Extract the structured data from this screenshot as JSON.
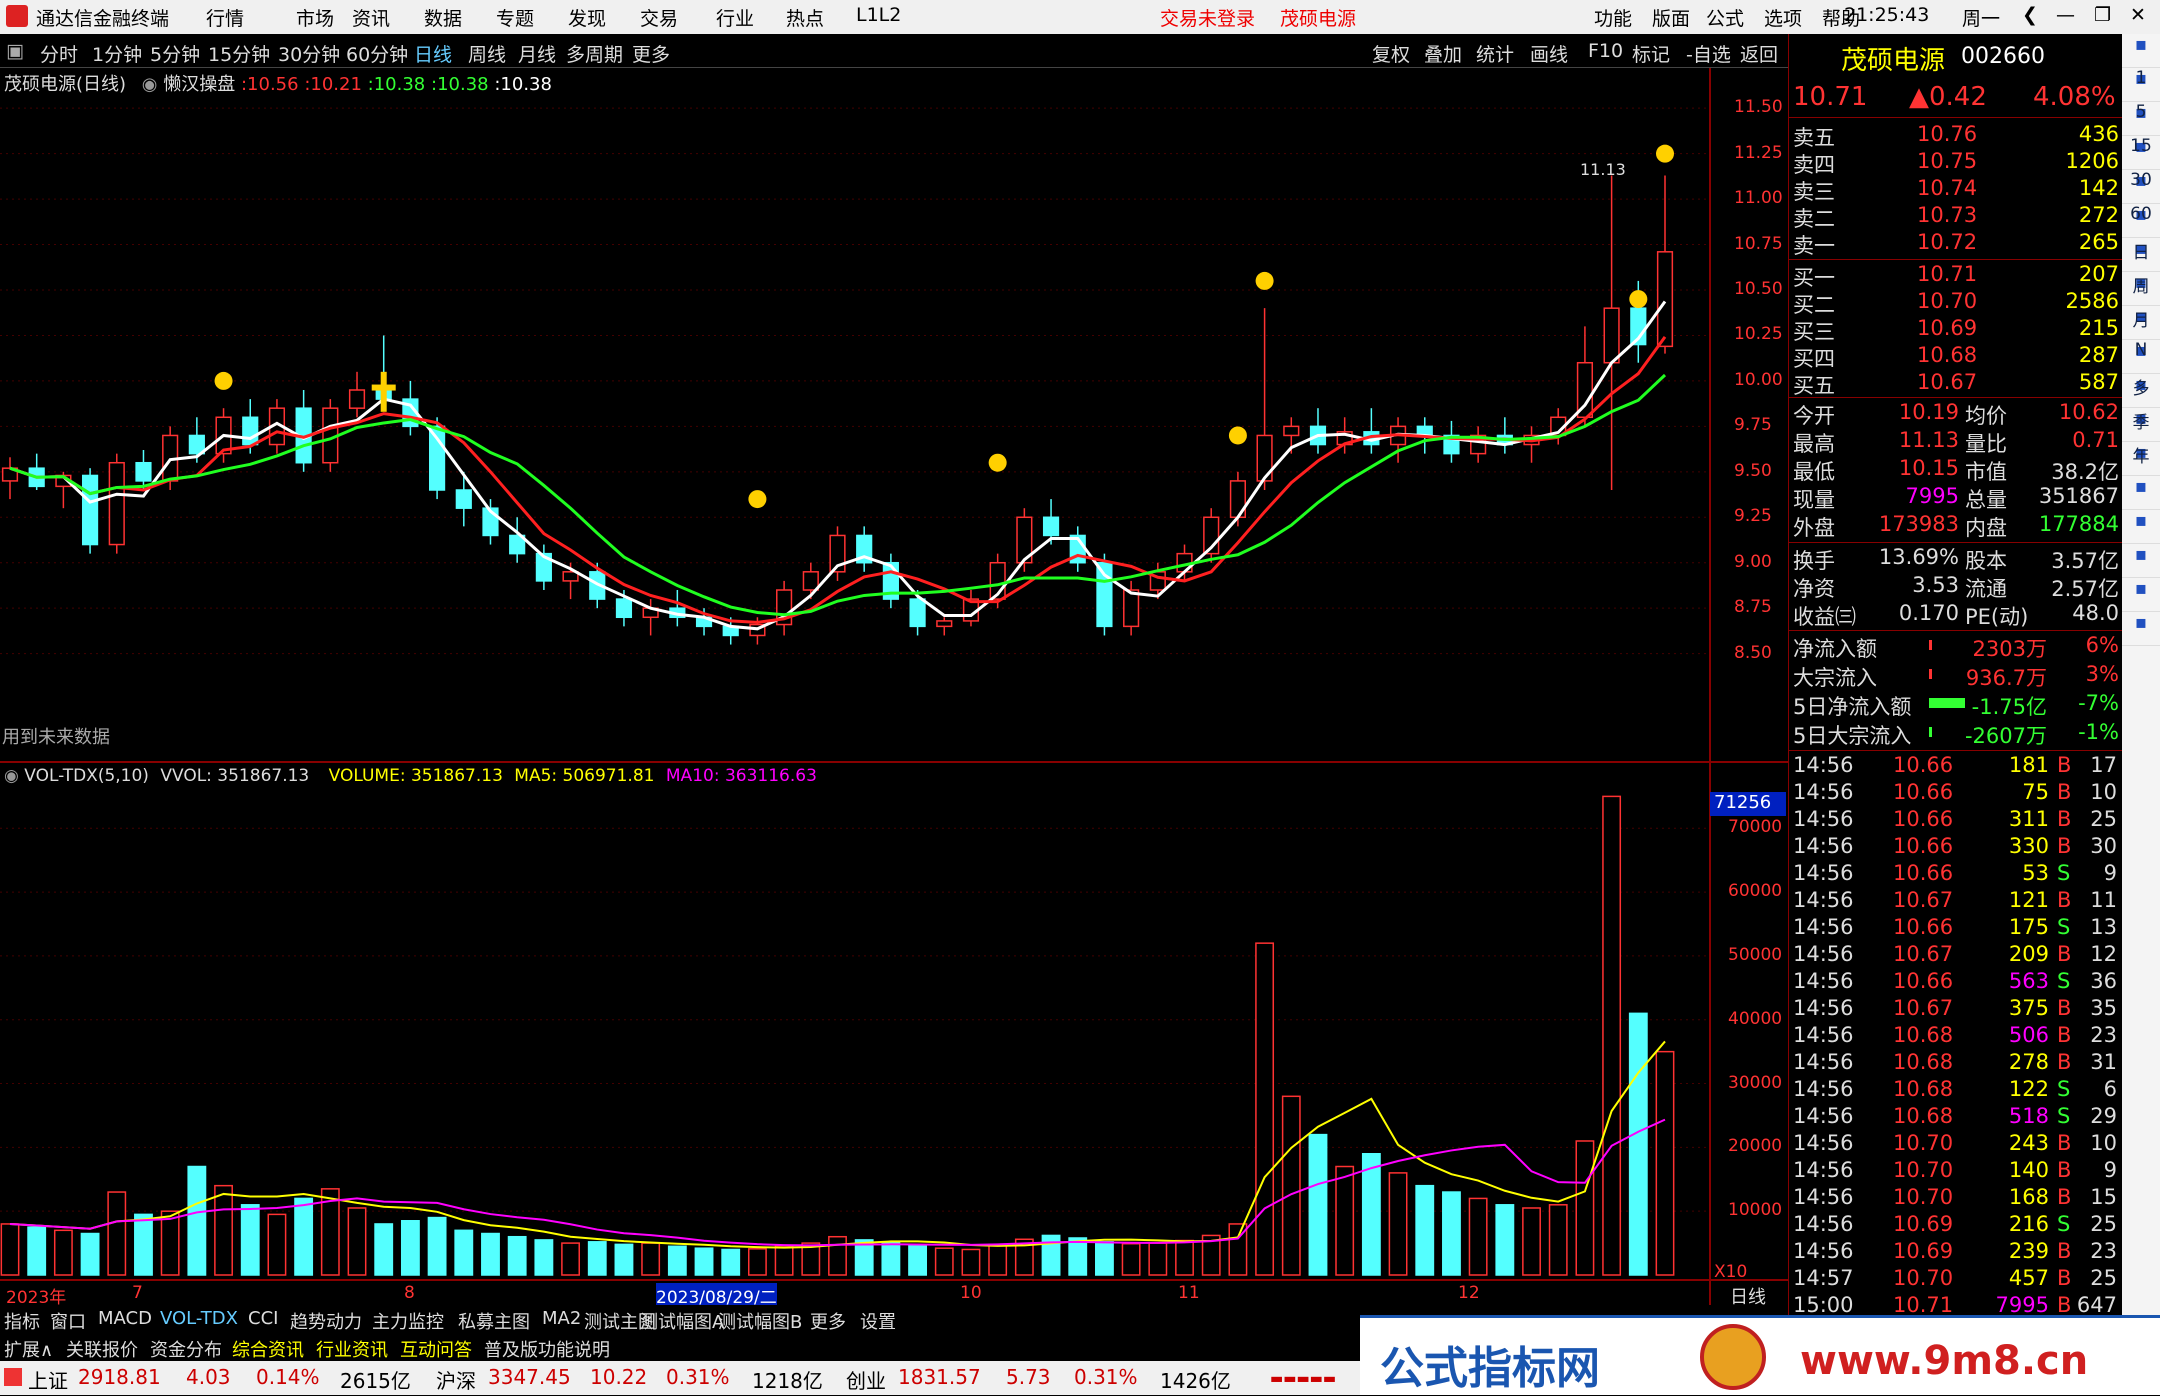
{
  "title_bar": {
    "app_name": "通达信金融终端",
    "menus": [
      "行情",
      "市场",
      "资讯",
      "数据",
      "专题",
      "发现",
      "交易",
      "行业",
      "热点",
      "L1L2"
    ],
    "trade_status": "交易未登录",
    "stock_title": "茂硕电源",
    "right_menus": [
      "功能",
      "版面",
      "公式",
      "选项",
      "帮助"
    ],
    "clock": "21:25:43",
    "weekday": "周一"
  },
  "period_tabs": [
    "分时",
    "1分钟",
    "5分钟",
    "15分钟",
    "30分钟",
    "60分钟",
    "日线",
    "周线",
    "月线",
    "多周期",
    "更多"
  ],
  "active_period": "日线",
  "right_tools": [
    "复权",
    "叠加",
    "统计",
    "画线",
    "F10",
    "标记",
    "-自选",
    "返回"
  ],
  "main_chart": {
    "header_name": "茂硕电源(日线)",
    "indicator": "懒汉操盘",
    "values": [
      ":10.56",
      ":10.21",
      ":10.38",
      ":10.38",
      ":10.38"
    ],
    "value_colors": [
      "#ff3333",
      "#ff3333",
      "#33ff33",
      "#33ff33",
      "#ffffff"
    ],
    "future_data_note": "用到未来数据",
    "high_label": "11.13",
    "y_ticks": [
      "11.50",
      "11.25",
      "11.00",
      "10.75",
      "10.50",
      "10.25",
      "10.00",
      "9.75",
      "9.50",
      "9.25",
      "9.00",
      "8.75",
      "8.50"
    ]
  },
  "volume_chart": {
    "header_name": "VOL-TDX(5,10)",
    "vvol": "VVOL: 351867.13",
    "volume": "VOLUME: 351867.13",
    "ma5": "MA5: 506971.81",
    "ma10": "MA10: 363116.63",
    "cursor_value": "71256",
    "y_ticks": [
      "70000",
      "60000",
      "50000",
      "40000",
      "30000",
      "20000",
      "10000"
    ],
    "unit": "X10"
  },
  "x_axis": {
    "labels": [
      "2023年",
      "7",
      "8",
      "2023/08/29/二",
      "10",
      "11",
      "12"
    ],
    "period_label": "日线"
  },
  "chart_data": {
    "type": "candlestick",
    "title": "茂硕电源(日线)",
    "ylim": [
      8.3,
      11.6
    ],
    "candles": [
      [
        9.45,
        9.58,
        9.35,
        9.52
      ],
      [
        9.52,
        9.6,
        9.4,
        9.42
      ],
      [
        9.42,
        9.5,
        9.3,
        9.48
      ],
      [
        9.48,
        9.52,
        9.05,
        9.1
      ],
      [
        9.1,
        9.6,
        9.05,
        9.55
      ],
      [
        9.55,
        9.62,
        9.4,
        9.45
      ],
      [
        9.45,
        9.75,
        9.4,
        9.7
      ],
      [
        9.7,
        9.8,
        9.55,
        9.6
      ],
      [
        9.6,
        9.85,
        9.55,
        9.8
      ],
      [
        9.8,
        9.9,
        9.6,
        9.65
      ],
      [
        9.65,
        9.9,
        9.6,
        9.85
      ],
      [
        9.85,
        9.95,
        9.5,
        9.55
      ],
      [
        9.55,
        9.9,
        9.5,
        9.85
      ],
      [
        9.85,
        10.05,
        9.8,
        9.95
      ],
      [
        9.95,
        10.25,
        9.85,
        9.9
      ],
      [
        9.9,
        10.0,
        9.7,
        9.75
      ],
      [
        9.75,
        9.8,
        9.35,
        9.4
      ],
      [
        9.4,
        9.5,
        9.2,
        9.3
      ],
      [
        9.3,
        9.35,
        9.1,
        9.15
      ],
      [
        9.15,
        9.25,
        9.0,
        9.05
      ],
      [
        9.05,
        9.1,
        8.85,
        8.9
      ],
      [
        8.9,
        9.0,
        8.8,
        8.95
      ],
      [
        8.95,
        9.0,
        8.75,
        8.8
      ],
      [
        8.8,
        8.85,
        8.65,
        8.7
      ],
      [
        8.7,
        8.8,
        8.6,
        8.75
      ],
      [
        8.75,
        8.85,
        8.65,
        8.7
      ],
      [
        8.7,
        8.75,
        8.6,
        8.65
      ],
      [
        8.65,
        8.7,
        8.55,
        8.6
      ],
      [
        8.6,
        8.7,
        8.55,
        8.66
      ],
      [
        8.66,
        8.9,
        8.6,
        8.85
      ],
      [
        8.85,
        9.0,
        8.8,
        8.95
      ],
      [
        8.95,
        9.2,
        8.9,
        9.15
      ],
      [
        9.15,
        9.2,
        8.95,
        9.0
      ],
      [
        9.0,
        9.05,
        8.75,
        8.8
      ],
      [
        8.8,
        8.85,
        8.6,
        8.65
      ],
      [
        8.65,
        8.7,
        8.6,
        8.68
      ],
      [
        8.68,
        8.85,
        8.65,
        8.8
      ],
      [
        8.8,
        9.05,
        8.75,
        9.0
      ],
      [
        9.0,
        9.3,
        8.95,
        9.25
      ],
      [
        9.25,
        9.35,
        9.1,
        9.15
      ],
      [
        9.15,
        9.2,
        8.95,
        9.0
      ],
      [
        9.0,
        9.05,
        8.6,
        8.65
      ],
      [
        8.65,
        8.9,
        8.6,
        8.85
      ],
      [
        8.85,
        9.0,
        8.8,
        8.95
      ],
      [
        8.95,
        9.1,
        8.9,
        9.05
      ],
      [
        9.05,
        9.3,
        9.0,
        9.25
      ],
      [
        9.25,
        9.5,
        9.2,
        9.45
      ],
      [
        9.45,
        10.4,
        9.4,
        9.7
      ],
      [
        9.7,
        9.8,
        9.6,
        9.75
      ],
      [
        9.75,
        9.85,
        9.6,
        9.65
      ],
      [
        9.65,
        9.8,
        9.6,
        9.72
      ],
      [
        9.72,
        9.85,
        9.6,
        9.65
      ],
      [
        9.65,
        9.8,
        9.55,
        9.75
      ],
      [
        9.75,
        9.8,
        9.6,
        9.7
      ],
      [
        9.7,
        9.78,
        9.55,
        9.6
      ],
      [
        9.6,
        9.75,
        9.55,
        9.7
      ],
      [
        9.7,
        9.8,
        9.6,
        9.65
      ],
      [
        9.65,
        9.75,
        9.55,
        9.7
      ],
      [
        9.7,
        9.85,
        9.65,
        9.8
      ],
      [
        9.8,
        10.3,
        9.75,
        10.1
      ],
      [
        10.1,
        11.13,
        9.4,
        10.4
      ],
      [
        10.4,
        10.55,
        10.1,
        10.2
      ],
      [
        10.19,
        11.13,
        10.15,
        10.71
      ]
    ]
  },
  "quote": {
    "name": "茂硕电源",
    "code": "002660",
    "price": "10.71",
    "change": "▲0.42",
    "pct": "4.08%",
    "asks": [
      [
        "卖五",
        "10.76",
        "436"
      ],
      [
        "卖四",
        "10.75",
        "1206"
      ],
      [
        "卖三",
        "10.74",
        "142"
      ],
      [
        "卖二",
        "10.73",
        "272"
      ],
      [
        "卖一",
        "10.72",
        "265"
      ]
    ],
    "bids": [
      [
        "买一",
        "10.71",
        "207"
      ],
      [
        "买二",
        "10.70",
        "2586"
      ],
      [
        "买三",
        "10.69",
        "215"
      ],
      [
        "买四",
        "10.68",
        "287"
      ],
      [
        "买五",
        "10.67",
        "587"
      ]
    ],
    "stats": [
      [
        "今开",
        "10.19",
        "均价",
        "10.62"
      ],
      [
        "最高",
        "11.13",
        "量比",
        "0.71"
      ],
      [
        "最低",
        "10.15",
        "市值",
        "38.2亿"
      ],
      [
        "现量",
        "7995",
        "总量",
        "351867"
      ],
      [
        "外盘",
        "173983",
        "内盘",
        "177884"
      ]
    ],
    "fundamentals": [
      [
        "换手",
        "13.69%",
        "股本",
        "3.57亿"
      ],
      [
        "净资",
        "3.53",
        "流通",
        "2.57亿"
      ],
      [
        "收益㈢",
        "0.170",
        "PE(动)",
        "48.0"
      ]
    ],
    "flows": [
      [
        "净流入额",
        "2303万",
        "6%"
      ],
      [
        "大宗流入",
        "936.7万",
        "3%"
      ],
      [
        "5日净流入额",
        "-1.75亿",
        "-7%"
      ],
      [
        "5日大宗流入",
        "-2607万",
        "-1%"
      ]
    ],
    "ticks": [
      [
        "14:56",
        "10.66",
        "181",
        "B",
        "17"
      ],
      [
        "14:56",
        "10.66",
        "75",
        "B",
        "10"
      ],
      [
        "14:56",
        "10.66",
        "311",
        "B",
        "25"
      ],
      [
        "14:56",
        "10.66",
        "330",
        "B",
        "30"
      ],
      [
        "14:56",
        "10.66",
        "53",
        "S",
        "9"
      ],
      [
        "14:56",
        "10.67",
        "121",
        "B",
        "11"
      ],
      [
        "14:56",
        "10.66",
        "175",
        "S",
        "13"
      ],
      [
        "14:56",
        "10.67",
        "209",
        "B",
        "12"
      ],
      [
        "14:56",
        "10.66",
        "563",
        "S",
        "36"
      ],
      [
        "14:56",
        "10.67",
        "375",
        "B",
        "35"
      ],
      [
        "14:56",
        "10.68",
        "506",
        "B",
        "23"
      ],
      [
        "14:56",
        "10.68",
        "278",
        "B",
        "31"
      ],
      [
        "14:56",
        "10.68",
        "122",
        "S",
        "6"
      ],
      [
        "14:56",
        "10.68",
        "518",
        "S",
        "29"
      ],
      [
        "14:56",
        "10.70",
        "243",
        "B",
        "10"
      ],
      [
        "14:56",
        "10.70",
        "140",
        "B",
        "9"
      ],
      [
        "14:56",
        "10.70",
        "168",
        "B",
        "15"
      ],
      [
        "14:56",
        "10.69",
        "216",
        "S",
        "25"
      ],
      [
        "14:56",
        "10.69",
        "239",
        "B",
        "23"
      ],
      [
        "14:57",
        "10.70",
        "457",
        "B",
        "25"
      ],
      [
        "15:00",
        "10.71",
        "7995",
        "B",
        "647"
      ]
    ]
  },
  "sidebar_periods": [
    "1",
    "5",
    "15",
    "30",
    "60",
    "日",
    "周",
    "月",
    "N",
    "多",
    "季",
    "年"
  ],
  "indicator_tabs": [
    "指标",
    "窗口",
    "MACD",
    "VOL-TDX",
    "CCI",
    "趋势动力",
    "主力监控",
    "私募主图",
    "MA2",
    "测试主图",
    "测试幅图A",
    "测试幅图B",
    "更多",
    "设置"
  ],
  "ext_tabs": [
    "扩展∧",
    "关联报价",
    "资金分布",
    "综合资讯",
    "行业资讯",
    "互动问答",
    "普及版功能说明"
  ],
  "status": {
    "sh_name": "上证",
    "sh_val": "2918.81",
    "sh_chg": "4.03",
    "sh_pct": "0.14%",
    "sh_amt": "2615亿",
    "hs_name": "沪深",
    "hs_val": "3347.45",
    "hs_chg": "10.22",
    "hs_pct": "0.31%",
    "hs_amt": "1218亿",
    "cy_name": "创业",
    "cy_val": "1831.57",
    "cy_chg": "5.73",
    "cy_pct": "0.31%",
    "cy_amt": "1426亿"
  },
  "banner": {
    "brand": "公式指标网",
    "site": "www.9m8.cn"
  }
}
